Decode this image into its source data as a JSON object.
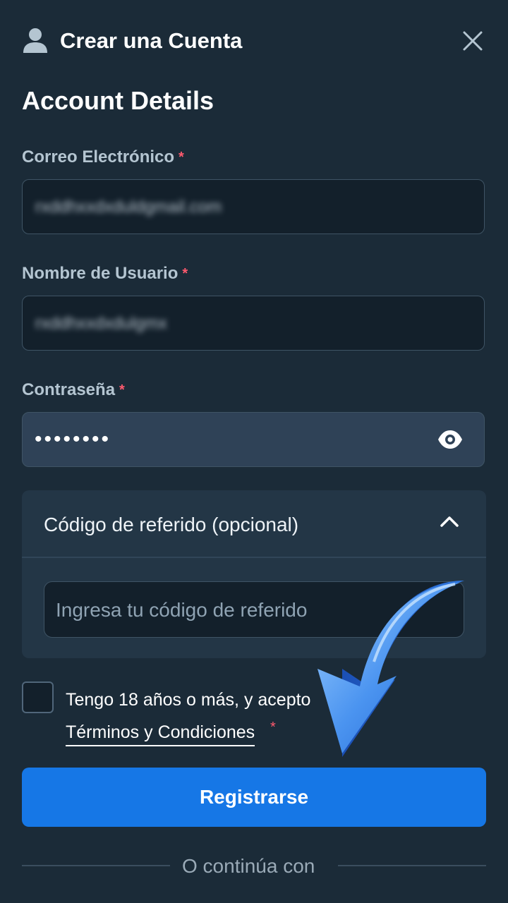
{
  "header": {
    "title": "Crear una Cuenta",
    "user_icon": "user-icon",
    "close_icon": "close-icon"
  },
  "section": {
    "title": "Account Details"
  },
  "fields": {
    "email": {
      "label": "Correo Electrónico",
      "required_mark": "*",
      "value": "rxddhxxdxduldgmail.com"
    },
    "username": {
      "label": "Nombre de Usuario",
      "required_mark": "*",
      "value": "rxddhxxdxdulgmx"
    },
    "password": {
      "label": "Contraseña",
      "required_mark": "*",
      "value": "••••••••",
      "toggle_icon": "eye-icon"
    }
  },
  "referral": {
    "title": "Código de referido (opcional)",
    "placeholder": "Ingresa tu código de referido",
    "expanded": true,
    "toggle_icon": "chevron-up-icon"
  },
  "terms": {
    "text": "Tengo 18 años o más, y acepto",
    "link": "Términos y Condiciones",
    "required_mark": "*",
    "checked": false
  },
  "register_button": {
    "label": "Registrarse"
  },
  "divider": {
    "text": "O continúa con"
  },
  "colors": {
    "background": "#1b2b38",
    "accent": "#1677e6",
    "required": "#ff5a6e",
    "label": "#b4c5d1"
  },
  "overlay": {
    "icon": "blue-curved-arrow-icon"
  }
}
